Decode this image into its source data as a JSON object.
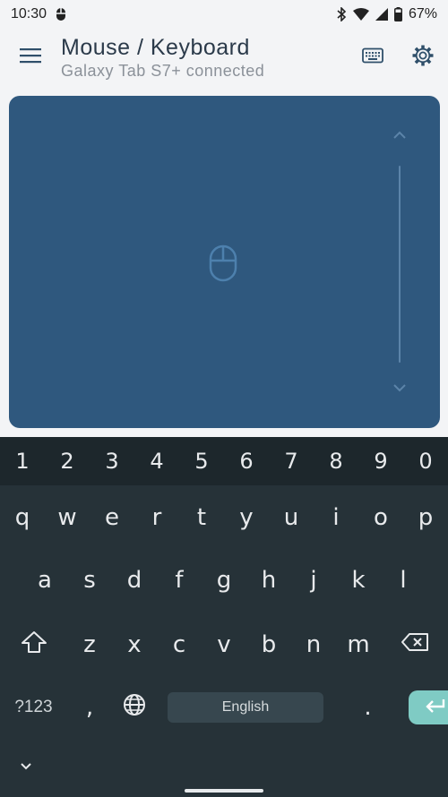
{
  "status_bar": {
    "time": "10:30",
    "battery": "67%"
  },
  "app_bar": {
    "title": "Mouse / Keyboard",
    "subtitle": "Galaxy Tab S7+ connected"
  },
  "keyboard": {
    "number_row": [
      "1",
      "2",
      "3",
      "4",
      "5",
      "6",
      "7",
      "8",
      "9",
      "0"
    ],
    "row1": [
      "q",
      "w",
      "e",
      "r",
      "t",
      "y",
      "u",
      "i",
      "o",
      "p"
    ],
    "row2": [
      "a",
      "s",
      "d",
      "f",
      "g",
      "h",
      "j",
      "k",
      "l"
    ],
    "row3": [
      "z",
      "x",
      "c",
      "v",
      "b",
      "n",
      "m"
    ],
    "symbols_label": "?123",
    "comma_label": ",",
    "space_label": "English",
    "period_label": "."
  },
  "colors": {
    "touchpad": "#2f587e",
    "keyboard_bg": "#263238",
    "enter_key": "#7fcbc4"
  }
}
